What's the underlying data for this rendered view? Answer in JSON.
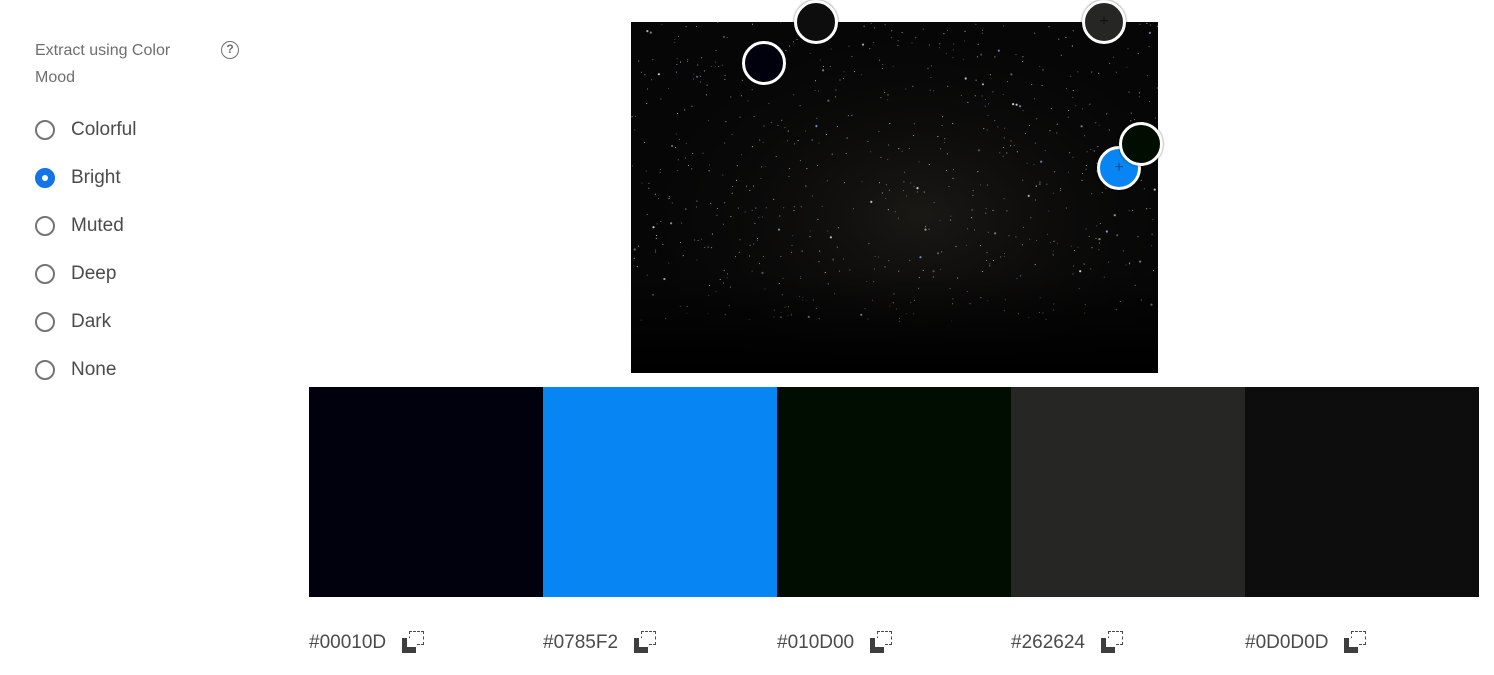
{
  "mood": {
    "title": "Extract using Color Mood",
    "help_icon": "?",
    "options": [
      {
        "label": "Colorful",
        "checked": false
      },
      {
        "label": "Bright",
        "checked": true
      },
      {
        "label": "Muted",
        "checked": false
      },
      {
        "label": "Deep",
        "checked": false
      },
      {
        "label": "Dark",
        "checked": false
      },
      {
        "label": "None",
        "checked": false
      }
    ]
  },
  "pickers": [
    {
      "color": "#00010D"
    },
    {
      "color": "#0D0D0D"
    },
    {
      "color": "#262624",
      "cross": "+"
    },
    {
      "color": "#0785F2",
      "cross": "+"
    },
    {
      "color": "#010D00"
    }
  ],
  "swatches": [
    {
      "hex": "#00010D"
    },
    {
      "hex": "#0785F2"
    },
    {
      "hex": "#010D00"
    },
    {
      "hex": "#262624"
    },
    {
      "hex": "#0D0D0D"
    }
  ],
  "accent_color": "#1473e6"
}
